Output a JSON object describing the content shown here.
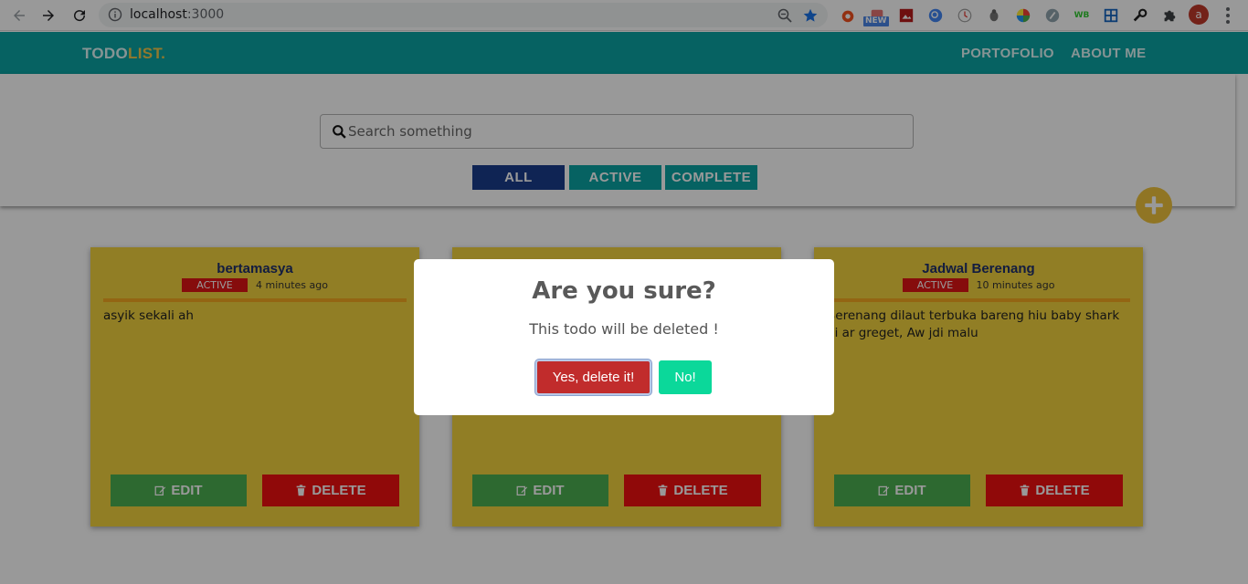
{
  "browser": {
    "url_host": "localhost",
    "url_port": ":3000",
    "avatar_letter": "a",
    "ext_new_badge": "NEW",
    "ext_wb_label": "WB"
  },
  "navbar": {
    "brand_main": "TODO",
    "brand_accent": "LIST.",
    "links": [
      "PORTOFOLIO",
      "ABOUT ME"
    ]
  },
  "search": {
    "placeholder": "Search something"
  },
  "filters": [
    {
      "label": "ALL",
      "color": "#1a3c8c"
    },
    {
      "label": "ACTIVE",
      "color": "#0aa3a3"
    },
    {
      "label": "COMPLETE",
      "color": "#0aa3a3"
    }
  ],
  "cards": [
    {
      "title": "bertamasya",
      "status": "ACTIVE",
      "time": "4 minutes ago",
      "body": "asyik sekali ah",
      "edit_label": "EDIT",
      "delete_label": "DELETE"
    },
    {
      "title": "",
      "status": "",
      "time": "",
      "body": "",
      "edit_label": "EDIT",
      "delete_label": "DELETE"
    },
    {
      "title": "Jadwal Berenang",
      "status": "ACTIVE",
      "time": "10 minutes ago",
      "body": "Berenang dilaut terbuka bareng hiu baby shark bi ar greget, Aw jdi malu",
      "edit_label": "EDIT",
      "delete_label": "DELETE"
    }
  ],
  "modal": {
    "title": "Are you sure?",
    "text": "This todo will be deleted !",
    "confirm_label": "Yes, delete it!",
    "cancel_label": "No!"
  },
  "colors": {
    "navbar": "#0aa3a3",
    "brand_accent": "#f2c94c",
    "card_bg": "#f2d23e",
    "card_divider": "#f6a820",
    "edit_button": "#4caf50",
    "delete_button": "#f01010",
    "confirm_button": "#c12c2c",
    "cancel_button": "#0bd89a",
    "fab": "#f0c43c"
  }
}
